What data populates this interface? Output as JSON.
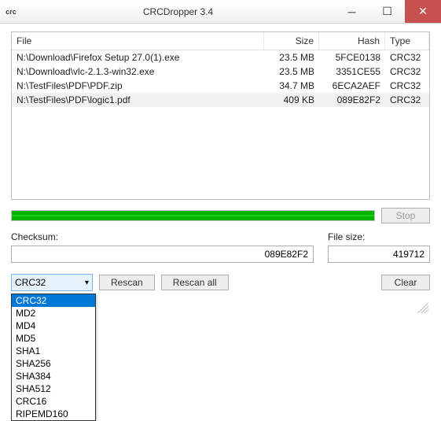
{
  "window": {
    "title": "CRCDropper 3.4",
    "icon_text": "crc"
  },
  "columns": {
    "file": "File",
    "size": "Size",
    "hash": "Hash",
    "type": "Type"
  },
  "rows": [
    {
      "file": "N:\\Download\\Firefox Setup 27.0(1).exe",
      "size": "23.5 MB",
      "hash": "5FCE0138",
      "type": "CRC32",
      "selected": false
    },
    {
      "file": "N:\\Download\\vlc-2.1.3-win32.exe",
      "size": "23.5 MB",
      "hash": "3351CE55",
      "type": "CRC32",
      "selected": false
    },
    {
      "file": "N:\\TestFiles\\PDF\\PDF.zip",
      "size": "34.7 MB",
      "hash": "6ECA2AEF",
      "type": "CRC32",
      "selected": false
    },
    {
      "file": "N:\\TestFiles\\PDF\\logic1.pdf",
      "size": "409 KB",
      "hash": "089E82F2",
      "type": "CRC32",
      "selected": true
    }
  ],
  "buttons": {
    "stop": "Stop",
    "rescan": "Rescan",
    "rescan_all": "Rescan all",
    "clear": "Clear"
  },
  "labels": {
    "checksum": "Checksum:",
    "filesize": "File size:"
  },
  "values": {
    "checksum": "089E82F2",
    "filesize": "419712"
  },
  "combo": {
    "selected": "CRC32"
  },
  "options": [
    "CRC32",
    "MD2",
    "MD4",
    "MD5",
    "SHA1",
    "SHA256",
    "SHA384",
    "SHA512",
    "CRC16",
    "RIPEMD160"
  ]
}
